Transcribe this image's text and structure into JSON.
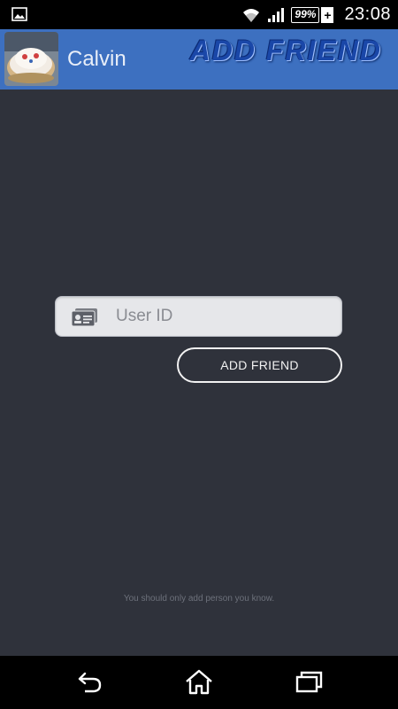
{
  "status_bar": {
    "notification_icon": "image-icon",
    "wifi_icon": "wifi-icon",
    "signal_icon": "signal-icon",
    "battery_level": "99%",
    "charging_symbol": "+",
    "time": "23:08"
  },
  "app_bar": {
    "avatar_icon": "avatar-photo",
    "user_name": "Calvin",
    "title": "ADD FRIEND",
    "background_color": "#3d70c0"
  },
  "form": {
    "input_icon": "id-card-icon",
    "user_id_placeholder": "User ID",
    "user_id_value": "",
    "add_button_label": "ADD FRIEND"
  },
  "hint_text": "You should only add person you know.",
  "nav_bar": {
    "back_icon": "back-icon",
    "home_icon": "home-icon",
    "recent_icon": "recent-apps-icon"
  }
}
